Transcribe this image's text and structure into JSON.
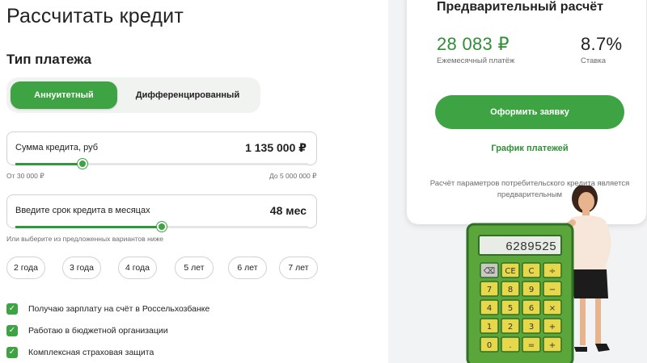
{
  "page": {
    "title": "Рассчитать кредит"
  },
  "payment_type": {
    "title": "Тип платежа",
    "options": [
      {
        "label": "Аннуитетный",
        "active": true
      },
      {
        "label": "Дифференцированный",
        "active": false
      }
    ]
  },
  "amount": {
    "label": "Сумма кредита, руб",
    "value": "1 135 000 ₽",
    "min_label": "От 30 000 ₽",
    "max_label": "До 5 000 000 ₽",
    "slider_fraction": 0.23
  },
  "term": {
    "label": "Введите срок кредита в месяцах",
    "value": "48 мес",
    "hint": "Или выберите из предложенных вариантов ниже",
    "slider_fraction": 0.5,
    "chips": [
      "2 года",
      "3 года",
      "4 года",
      "5 лет",
      "6 лет",
      "7 лет"
    ]
  },
  "options": [
    {
      "label": "Получаю зарплату на счёт в Россельхозбанке",
      "checked": true
    },
    {
      "label": "Работаю в бюджетной организации",
      "checked": true
    },
    {
      "label": "Комплексная страховая защита",
      "checked": true
    }
  ],
  "summary": {
    "title": "Предварительный расчёт",
    "monthly_value": "28 083 ₽",
    "monthly_caption": "Ежемесячный платёж",
    "rate_value": "8.7%",
    "rate_caption": "Ставка",
    "apply_label": "Оформить заявку",
    "schedule_label": "График платежей",
    "disclaimer": "Расчёт параметров потребительского кредита является предварительным"
  },
  "illustration": {
    "calculator_display": "6289525",
    "keys": [
      "⌫",
      "CE",
      "C",
      "÷",
      "7",
      "8",
      "9",
      "−",
      "4",
      "5",
      "6",
      "×",
      "1",
      "2",
      "3",
      "+",
      "0",
      ".",
      "=",
      "+"
    ]
  },
  "colors": {
    "accent": "#3ea343",
    "accent_text": "#2f8f36",
    "calculator_body": "#5aa63a",
    "calculator_keys": "#e6d84a"
  }
}
